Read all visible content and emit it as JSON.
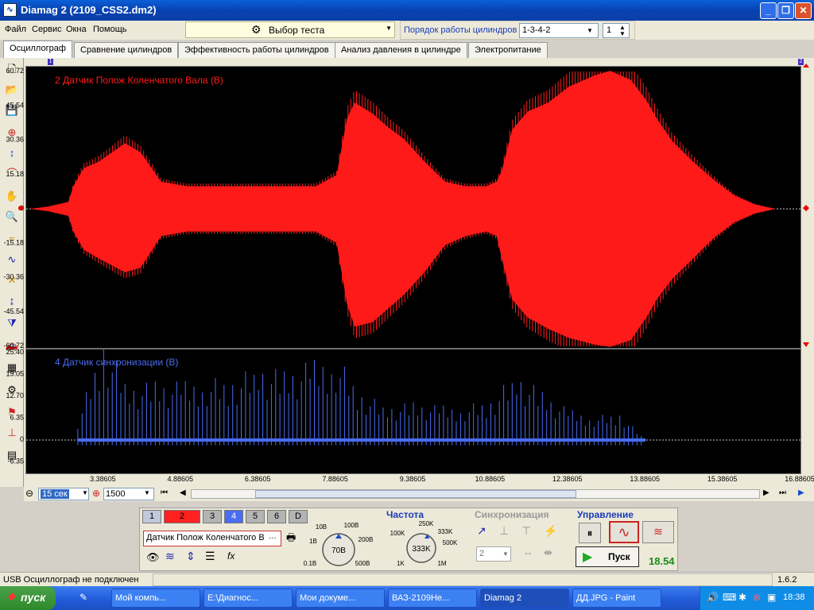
{
  "window": {
    "title": "Diamag 2 (2109_CSS2.dm2)"
  },
  "menu": {
    "items": [
      "Файл",
      "Сервис",
      "Окна",
      "Помощь"
    ]
  },
  "test_selector": {
    "label": "Выбор теста"
  },
  "cylinders": {
    "label": "Порядок работы цилиндров",
    "order": "1-3-4-2",
    "count": "1"
  },
  "tabs": [
    "Осциллограф",
    "Сравнение цилиндров",
    "Эффективность работы цилиндров",
    "Анализ давления в цилиндре",
    "Электропитание"
  ],
  "active_tab": 0,
  "colors": {
    "channel2": "#ff1a1a",
    "channel4": "#4a6cf0",
    "background": "#000000"
  },
  "cursor_markers": {
    "left": "1",
    "right": "2"
  },
  "chart_data": [
    {
      "type": "line",
      "title": "2 Датчик Полож Коленчатого Вала (В)",
      "ylim": [
        -60.72,
        60.72
      ],
      "yticks": [
        "60.72",
        "45.54",
        "30.36",
        "15.18",
        "0",
        "-15.18",
        "-30.36",
        "-45.54",
        "-60.72"
      ],
      "series": [
        {
          "name": "2 Датчик Полож Коленчатого Вала (В)",
          "x": [
            1.96,
            2.3,
            2.7,
            2.8,
            3.0,
            3.3,
            3.8,
            4.1,
            4.5,
            5.0,
            5.5,
            6.0,
            6.5,
            7.0,
            7.5,
            7.9,
            8.1,
            8.25,
            8.6,
            8.9,
            9.2,
            9.6,
            10.0,
            10.4,
            10.8,
            11.0,
            11.1,
            11.3,
            11.6,
            12.0,
            12.4,
            12.9,
            13.2,
            13.6,
            13.9,
            14.1,
            14.4,
            14.8,
            15.2,
            15.6,
            16.0,
            16.4,
            16.9
          ],
          "ymax": [
            0,
            1,
            3,
            10,
            18,
            21,
            29,
            25,
            12,
            10,
            10,
            10,
            10,
            10,
            10,
            15,
            40,
            47,
            42,
            36,
            31,
            21,
            12,
            10,
            10,
            12,
            17,
            35,
            43,
            47,
            54,
            59,
            61,
            57,
            48,
            40,
            30,
            21,
            13,
            6,
            2,
            0,
            0
          ],
          "ymin": [
            0,
            -1,
            -3,
            -10,
            -18,
            -22,
            -28,
            -26,
            -12,
            -10,
            -10,
            -10,
            -10,
            -10,
            -10,
            -15,
            -42,
            -52,
            -50,
            -44,
            -38,
            -28,
            -16,
            -12,
            -10,
            -12,
            -22,
            -40,
            -48,
            -53,
            -57,
            -60,
            -61,
            -58,
            -48,
            -40,
            -31,
            -22,
            -13,
            -6,
            -2,
            0,
            0
          ]
        }
      ]
    },
    {
      "type": "line",
      "title": "4 Датчик синхронизации (В)",
      "ylim": [
        -8,
        25.4
      ],
      "yticks": [
        "25.40",
        "19.05",
        "12.70",
        "6.35",
        "0",
        "-6.35"
      ],
      "x": [
        2.88605,
        3.38605,
        3.88605,
        4.38605,
        4.88605,
        5.38605,
        5.88605,
        6.38605,
        6.88605,
        7.38605,
        7.88605,
        8.38605,
        8.88605,
        9.38605,
        9.88605,
        10.38605,
        10.88605,
        11.38605,
        11.88605,
        12.38605,
        12.88605,
        13.38605,
        13.88605
      ],
      "xlim": [
        1.88605,
        16.88605
      ],
      "xticks": [
        "3.38605",
        "4.88605",
        "6.38605",
        "7.88605",
        "9.38605",
        "10.88605",
        "12.38605",
        "13.88605",
        "15.38605",
        "16.88605"
      ],
      "series": [
        {
          "name": "4 Датчик синхронизации (В)",
          "peak": [
            6,
            30,
            16,
            17,
            17,
            18,
            18,
            22,
            20,
            23,
            25,
            14,
            10,
            11,
            10,
            10,
            12,
            20,
            14,
            9,
            7,
            8,
            0
          ]
        }
      ]
    }
  ],
  "timebar": {
    "zoom": "15 сек",
    "rate": "1500"
  },
  "channels": {
    "buttons": [
      "1",
      "2",
      "3",
      "4",
      "5",
      "6",
      "D"
    ],
    "selected": "Датчик Полож Коленчатого В"
  },
  "amplitude_knob": {
    "labels": [
      "10В",
      "100В",
      "1В",
      "200В",
      "0.1В",
      "500В"
    ],
    "value": "70В"
  },
  "frequency": {
    "title": "Частота",
    "labels": [
      "250K",
      "100K",
      "333K",
      "500K",
      "1K",
      "1M"
    ],
    "value": "333K"
  },
  "sync": {
    "title": "Синхронизация",
    "channel": "2"
  },
  "control": {
    "title": "Управление",
    "start": "Пуск",
    "time": "18.54"
  },
  "status": {
    "left": "USB Осциллограф не подключен",
    "right": "1.6.2"
  },
  "taskbar": {
    "start": "пуск",
    "tasks": [
      "Мой компь...",
      "E:\\Диагнос...",
      "Мои докуме...",
      "ВАЗ-2109Не...",
      "Diamag 2",
      "ДД.JPG - Paint"
    ],
    "clock": "18:38"
  }
}
